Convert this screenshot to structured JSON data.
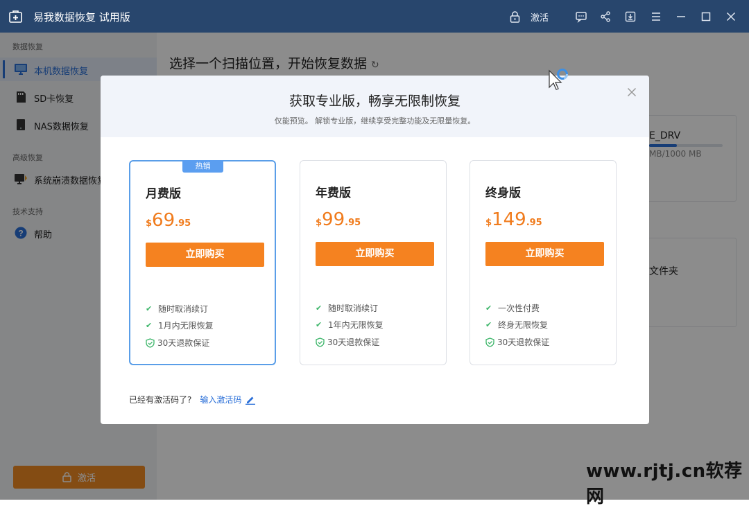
{
  "app": {
    "title": "易我数据恢复 试用版",
    "activate_label": "激活"
  },
  "sidebar": {
    "sections": [
      {
        "heading": "数据恢复",
        "items": [
          {
            "label": "本机数据恢复",
            "icon": "monitor-icon",
            "active": true
          },
          {
            "label": "SD卡恢复",
            "icon": "sd-card-icon"
          },
          {
            "label": "NAS数据恢复",
            "icon": "nas-icon"
          }
        ]
      },
      {
        "heading": "高级恢复",
        "items": [
          {
            "label": "系统崩溃数据恢复",
            "icon": "crash-recovery-icon"
          }
        ]
      },
      {
        "heading": "技术支持",
        "items": [
          {
            "label": "帮助",
            "icon": "help-icon"
          }
        ]
      }
    ],
    "activate_button": "激活"
  },
  "main": {
    "title": "选择一个扫描位置，开始恢复数据",
    "drive": {
      "name": "E_DRV",
      "size_text": "MB/1000 MB",
      "used_fraction": 0.38
    },
    "folder_label": "文件夹"
  },
  "modal": {
    "title": "获取专业版，畅享无限制恢复",
    "subtitle": "仅能预览。 解锁专业版，继续享受完整功能及无限量恢复。",
    "plans": [
      {
        "name": "月费版",
        "badge": "热销",
        "currency": "$",
        "price_int": "69",
        "price_dec": ".95",
        "buy": "立即购买",
        "features": [
          "随时取消续订",
          "1月内无限恢复",
          "30天退款保证"
        ]
      },
      {
        "name": "年费版",
        "currency": "$",
        "price_int": "99",
        "price_dec": ".95",
        "buy": "立即购买",
        "features": [
          "随时取消续订",
          "1年内无限恢复",
          "30天退款保证"
        ]
      },
      {
        "name": "终身版",
        "currency": "$",
        "price_int": "149",
        "price_dec": ".95",
        "buy": "立即购买",
        "features": [
          "一次性付费",
          "终身无限恢复",
          "30天退款保证"
        ]
      }
    ],
    "redeem_prompt": "已经有激活码了?",
    "redeem_link": "输入激活码"
  },
  "watermark": "www.rjtj.cn软荐网",
  "colors": {
    "titlebar": "#28466d",
    "accent": "#2a6fd8",
    "buy": "#f58220",
    "price": "#f07b1c",
    "check": "#3db66a"
  }
}
